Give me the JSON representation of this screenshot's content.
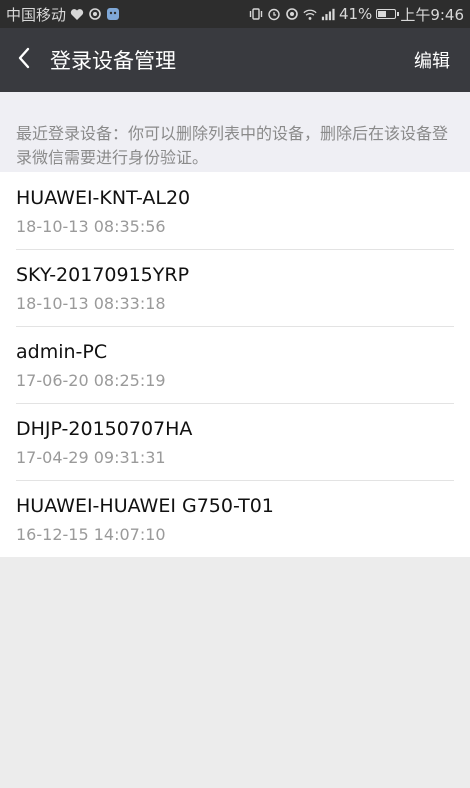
{
  "status_bar": {
    "carrier": "中国移动",
    "battery": "41%",
    "time": "上午9:46",
    "icons": [
      "heart-icon",
      "eye-icon",
      "app-icon",
      "vibrate-icon",
      "alarm-icon",
      "eye-icon",
      "wifi-icon",
      "signal-icon",
      "battery-icon"
    ]
  },
  "header": {
    "title": "登录设备管理",
    "edit_label": "编辑",
    "back_icon": "chevron-left-icon"
  },
  "notice": {
    "text": "最近登录设备：你可以删除列表中的设备，删除后在该设备登录微信需要进行身份验证。"
  },
  "devices": [
    {
      "name": "HUAWEI-KNT-AL20",
      "time": "18-10-13 08:35:56"
    },
    {
      "name": "SKY-20170915YRP",
      "time": "18-10-13 08:33:18"
    },
    {
      "name": "admin-PC",
      "time": "17-06-20 08:25:19"
    },
    {
      "name": "DHJP-20150707HA",
      "time": "17-04-29 09:31:31"
    },
    {
      "name": "HUAWEI-HUAWEI G750-T01",
      "time": "16-12-15 14:07:10"
    }
  ],
  "colors": {
    "status_bar_bg": "#2d2d2d",
    "action_bar_bg": "#393a3f",
    "page_bg": "#ececec",
    "notice_text": "#8a8a8a",
    "secondary_text": "#9a9a9a"
  }
}
